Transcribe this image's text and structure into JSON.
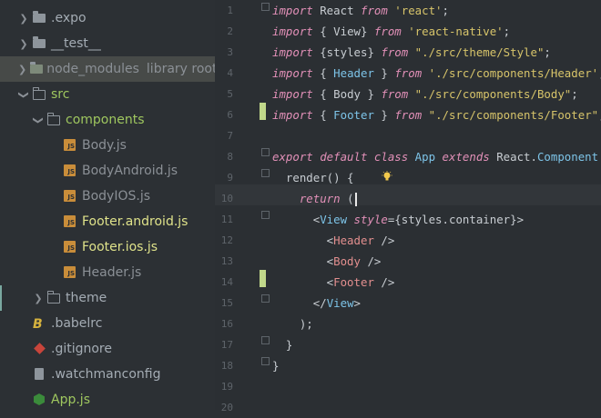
{
  "sidebar": {
    "items": [
      {
        "label": ".expo",
        "type": "folder"
      },
      {
        "label": "__test__",
        "type": "folder"
      },
      {
        "label": "node_modules",
        "type": "folder",
        "badge": "library root"
      },
      {
        "label": "src",
        "type": "folder"
      },
      {
        "label": "components",
        "type": "folder"
      },
      {
        "label": "Body.js",
        "type": "js"
      },
      {
        "label": "BodyAndroid.js",
        "type": "js"
      },
      {
        "label": "BodyIOS.js",
        "type": "js"
      },
      {
        "label": "Footer.android.js",
        "type": "js"
      },
      {
        "label": "Footer.ios.js",
        "type": "js"
      },
      {
        "label": "Header.js",
        "type": "js"
      },
      {
        "label": "theme",
        "type": "folder"
      },
      {
        "label": ".babelrc",
        "type": "babel"
      },
      {
        "label": ".gitignore",
        "type": "git"
      },
      {
        "label": ".watchmanconfig",
        "type": "file"
      },
      {
        "label": "App.js",
        "type": "node"
      }
    ]
  },
  "editor": {
    "line_numbers": [
      "1",
      "2",
      "3",
      "4",
      "5",
      "6",
      "7",
      "8",
      "9",
      "10",
      "11",
      "12",
      "13",
      "14",
      "15",
      "16",
      "17",
      "18",
      "19",
      "20"
    ],
    "current_line": 10,
    "lines": [
      [
        [
          "kw",
          "import"
        ],
        [
          "pun",
          " React "
        ],
        [
          "kw",
          "from"
        ],
        [
          "str",
          " 'react'"
        ],
        [
          "pun",
          ";"
        ]
      ],
      [
        [
          "kw",
          "import"
        ],
        [
          "pun",
          " { View} "
        ],
        [
          "kw",
          "from"
        ],
        [
          "str",
          " 'react-native'"
        ],
        [
          "pun",
          ";"
        ]
      ],
      [
        [
          "kw",
          "import"
        ],
        [
          "pun",
          " {styles} "
        ],
        [
          "kw",
          "from"
        ],
        [
          "str",
          " \"./src/theme/Style\""
        ],
        [
          "pun",
          ";"
        ]
      ],
      [
        [
          "kw",
          "import"
        ],
        [
          "pun",
          " { "
        ],
        [
          "cls",
          "Header"
        ],
        [
          "pun",
          " } "
        ],
        [
          "kw",
          "from"
        ],
        [
          "str",
          " './src/components/Header'"
        ],
        [
          "pun",
          ";"
        ]
      ],
      [
        [
          "kw",
          "import"
        ],
        [
          "pun",
          " { Body } "
        ],
        [
          "kw",
          "from"
        ],
        [
          "str",
          " \"./src/components/Body\""
        ],
        [
          "pun",
          ";"
        ]
      ],
      [
        [
          "kw",
          "import"
        ],
        [
          "pun",
          " { "
        ],
        [
          "cls",
          "Footer"
        ],
        [
          "pun",
          " } "
        ],
        [
          "kw",
          "from"
        ],
        [
          "str",
          " \"./src/components/Footer\""
        ],
        [
          "pun",
          ";"
        ]
      ],
      [],
      [
        [
          "kw",
          "export default class"
        ],
        [
          "pun",
          " "
        ],
        [
          "cls",
          "App"
        ],
        [
          "pun",
          " "
        ],
        [
          "kw",
          "extends"
        ],
        [
          "pun",
          " React."
        ],
        [
          "cls",
          "Component"
        ],
        [
          "pun",
          " {"
        ]
      ],
      [
        [
          "pun",
          "  render() {"
        ]
      ],
      [
        [
          "kw",
          "    return"
        ],
        [
          "pun",
          " ("
        ]
      ],
      [
        [
          "pun",
          "      <"
        ],
        [
          "cls",
          "View"
        ],
        [
          "pun",
          " "
        ],
        [
          "attr",
          "style"
        ],
        [
          "pun",
          "={styles.container}>"
        ]
      ],
      [
        [
          "pun",
          "        <"
        ],
        [
          "tag",
          "Header"
        ],
        [
          "pun",
          " />"
        ]
      ],
      [
        [
          "pun",
          "        <"
        ],
        [
          "tag",
          "Body"
        ],
        [
          "pun",
          " />"
        ]
      ],
      [
        [
          "pun",
          "        <"
        ],
        [
          "tag",
          "Footer"
        ],
        [
          "pun",
          " />"
        ]
      ],
      [
        [
          "pun",
          "      </"
        ],
        [
          "cls",
          "View"
        ],
        [
          "pun",
          ">"
        ]
      ],
      [
        [
          "pun",
          "    );"
        ]
      ],
      [
        [
          "pun",
          "  }"
        ]
      ],
      [
        [
          "pun",
          "}"
        ]
      ],
      [],
      []
    ]
  }
}
